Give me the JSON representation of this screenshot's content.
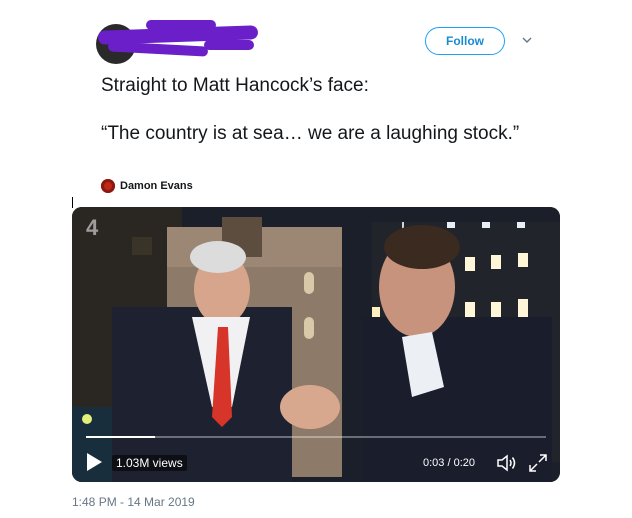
{
  "header": {
    "follow_label": "Follow",
    "chevron_icon": "chevron-down-icon",
    "redaction_color": "#6b1fc9"
  },
  "tweet": {
    "line1": "Straight to Matt Hancock’s face:",
    "line2": "“The country is at sea… we are a laughing stock.”"
  },
  "credit": {
    "name": "Damon Evans"
  },
  "video": {
    "views": "1.03M views",
    "time": "0:03 / 0:20",
    "progress": 0.15,
    "channel_logo": "4",
    "icons": {
      "play": "play-icon",
      "volume": "volume-icon",
      "fullscreen": "fullscreen-icon"
    }
  },
  "footer": {
    "timestamp": "1:48 PM - 14 Mar 2019"
  },
  "colors": {
    "accent": "#1da1f2",
    "text": "#14171a",
    "muted": "#657786"
  }
}
